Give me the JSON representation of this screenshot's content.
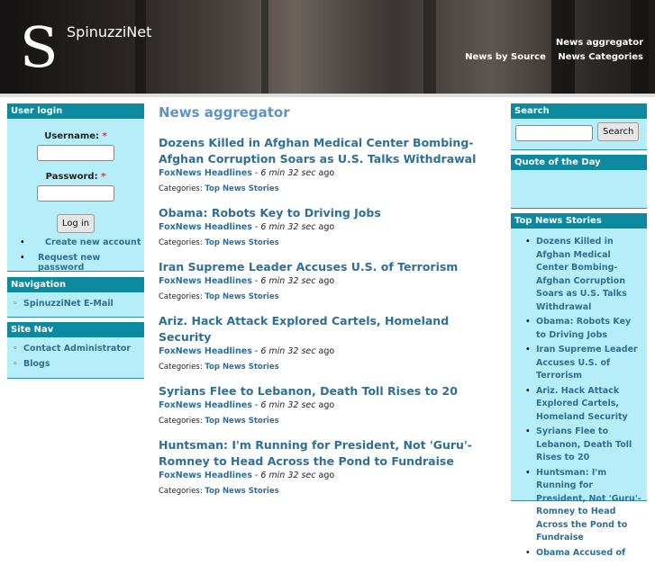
{
  "header": {
    "logo_letter": "S",
    "site_name": "SpinuzziNet",
    "nav_primary": "News aggregator",
    "nav_secondary": [
      "News by Source",
      "News Categories"
    ]
  },
  "left": {
    "login": {
      "title": "User login",
      "username_label": "Username:",
      "password_label": "Password:",
      "required": "*",
      "login_button": "Log in",
      "links": [
        "Create new account",
        "Request new password"
      ]
    },
    "navigation": {
      "title": "Navigation",
      "links": [
        "SpinuzziNet E-Mail"
      ]
    },
    "site_nav": {
      "title": "Site Nav",
      "links": [
        "Contact Administrator",
        "Blogs"
      ]
    }
  },
  "main": {
    "title": "News aggregator",
    "items": [
      {
        "title": "Dozens Killed in Afghan Medical Center Bombing- Afghan Corruption Soars as U.S. Talks Withdrawal",
        "source": "FoxNews Headlines",
        "age": "6 min 32 sec",
        "ago": "ago",
        "cat_label": "Categories:",
        "category": "Top News Stories"
      },
      {
        "title": "Obama: Robots Key to Driving Jobs",
        "source": "FoxNews Headlines",
        "age": "6 min 32 sec",
        "ago": "ago",
        "cat_label": "Categories:",
        "category": "Top News Stories"
      },
      {
        "title": "Iran Supreme Leader Accuses U.S. of Terrorism",
        "source": "FoxNews Headlines",
        "age": "6 min 32 sec",
        "ago": "ago",
        "cat_label": "Categories:",
        "category": "Top News Stories"
      },
      {
        "title": "Ariz. Hack Attack Explored Cartels, Homeland Security",
        "source": "FoxNews Headlines",
        "age": "6 min 32 sec",
        "ago": "ago",
        "cat_label": "Categories:",
        "category": "Top News Stories"
      },
      {
        "title": "Syrians Flee to Lebanon, Death Toll Rises to 20",
        "source": "FoxNews Headlines",
        "age": "6 min 32 sec",
        "ago": "ago",
        "cat_label": "Categories:",
        "category": "Top News Stories"
      },
      {
        "title": "Huntsman: I'm Running for President, Not 'Guru'- Romney to Head Across the Pond to Fundraise",
        "source": "FoxNews Headlines",
        "age": "6 min 32 sec",
        "ago": "ago",
        "cat_label": "Categories:",
        "category": "Top News Stories"
      }
    ]
  },
  "right": {
    "search": {
      "title": "Search",
      "button": "Search",
      "value": ""
    },
    "quote": {
      "title": "Quote of the Day"
    },
    "top_news": {
      "title": "Top News Stories",
      "items": [
        "Dozens Killed in Afghan Medical Center Bombing- Afghan Corruption Soars as U.S. Talks Withdrawal",
        "Obama: Robots Key to Driving Jobs",
        "Iran Supreme Leader Accuses U.S. of Terrorism",
        "Ariz. Hack Attack Explored Cartels, Homeland Security",
        "Syrians Flee to Lebanon, Death Toll Rises to 20",
        "Huntsman: I'm Running for President, Not 'Guru'- Romney to Head Across the Pond to Fundraise",
        "Obama Accused of"
      ]
    }
  }
}
